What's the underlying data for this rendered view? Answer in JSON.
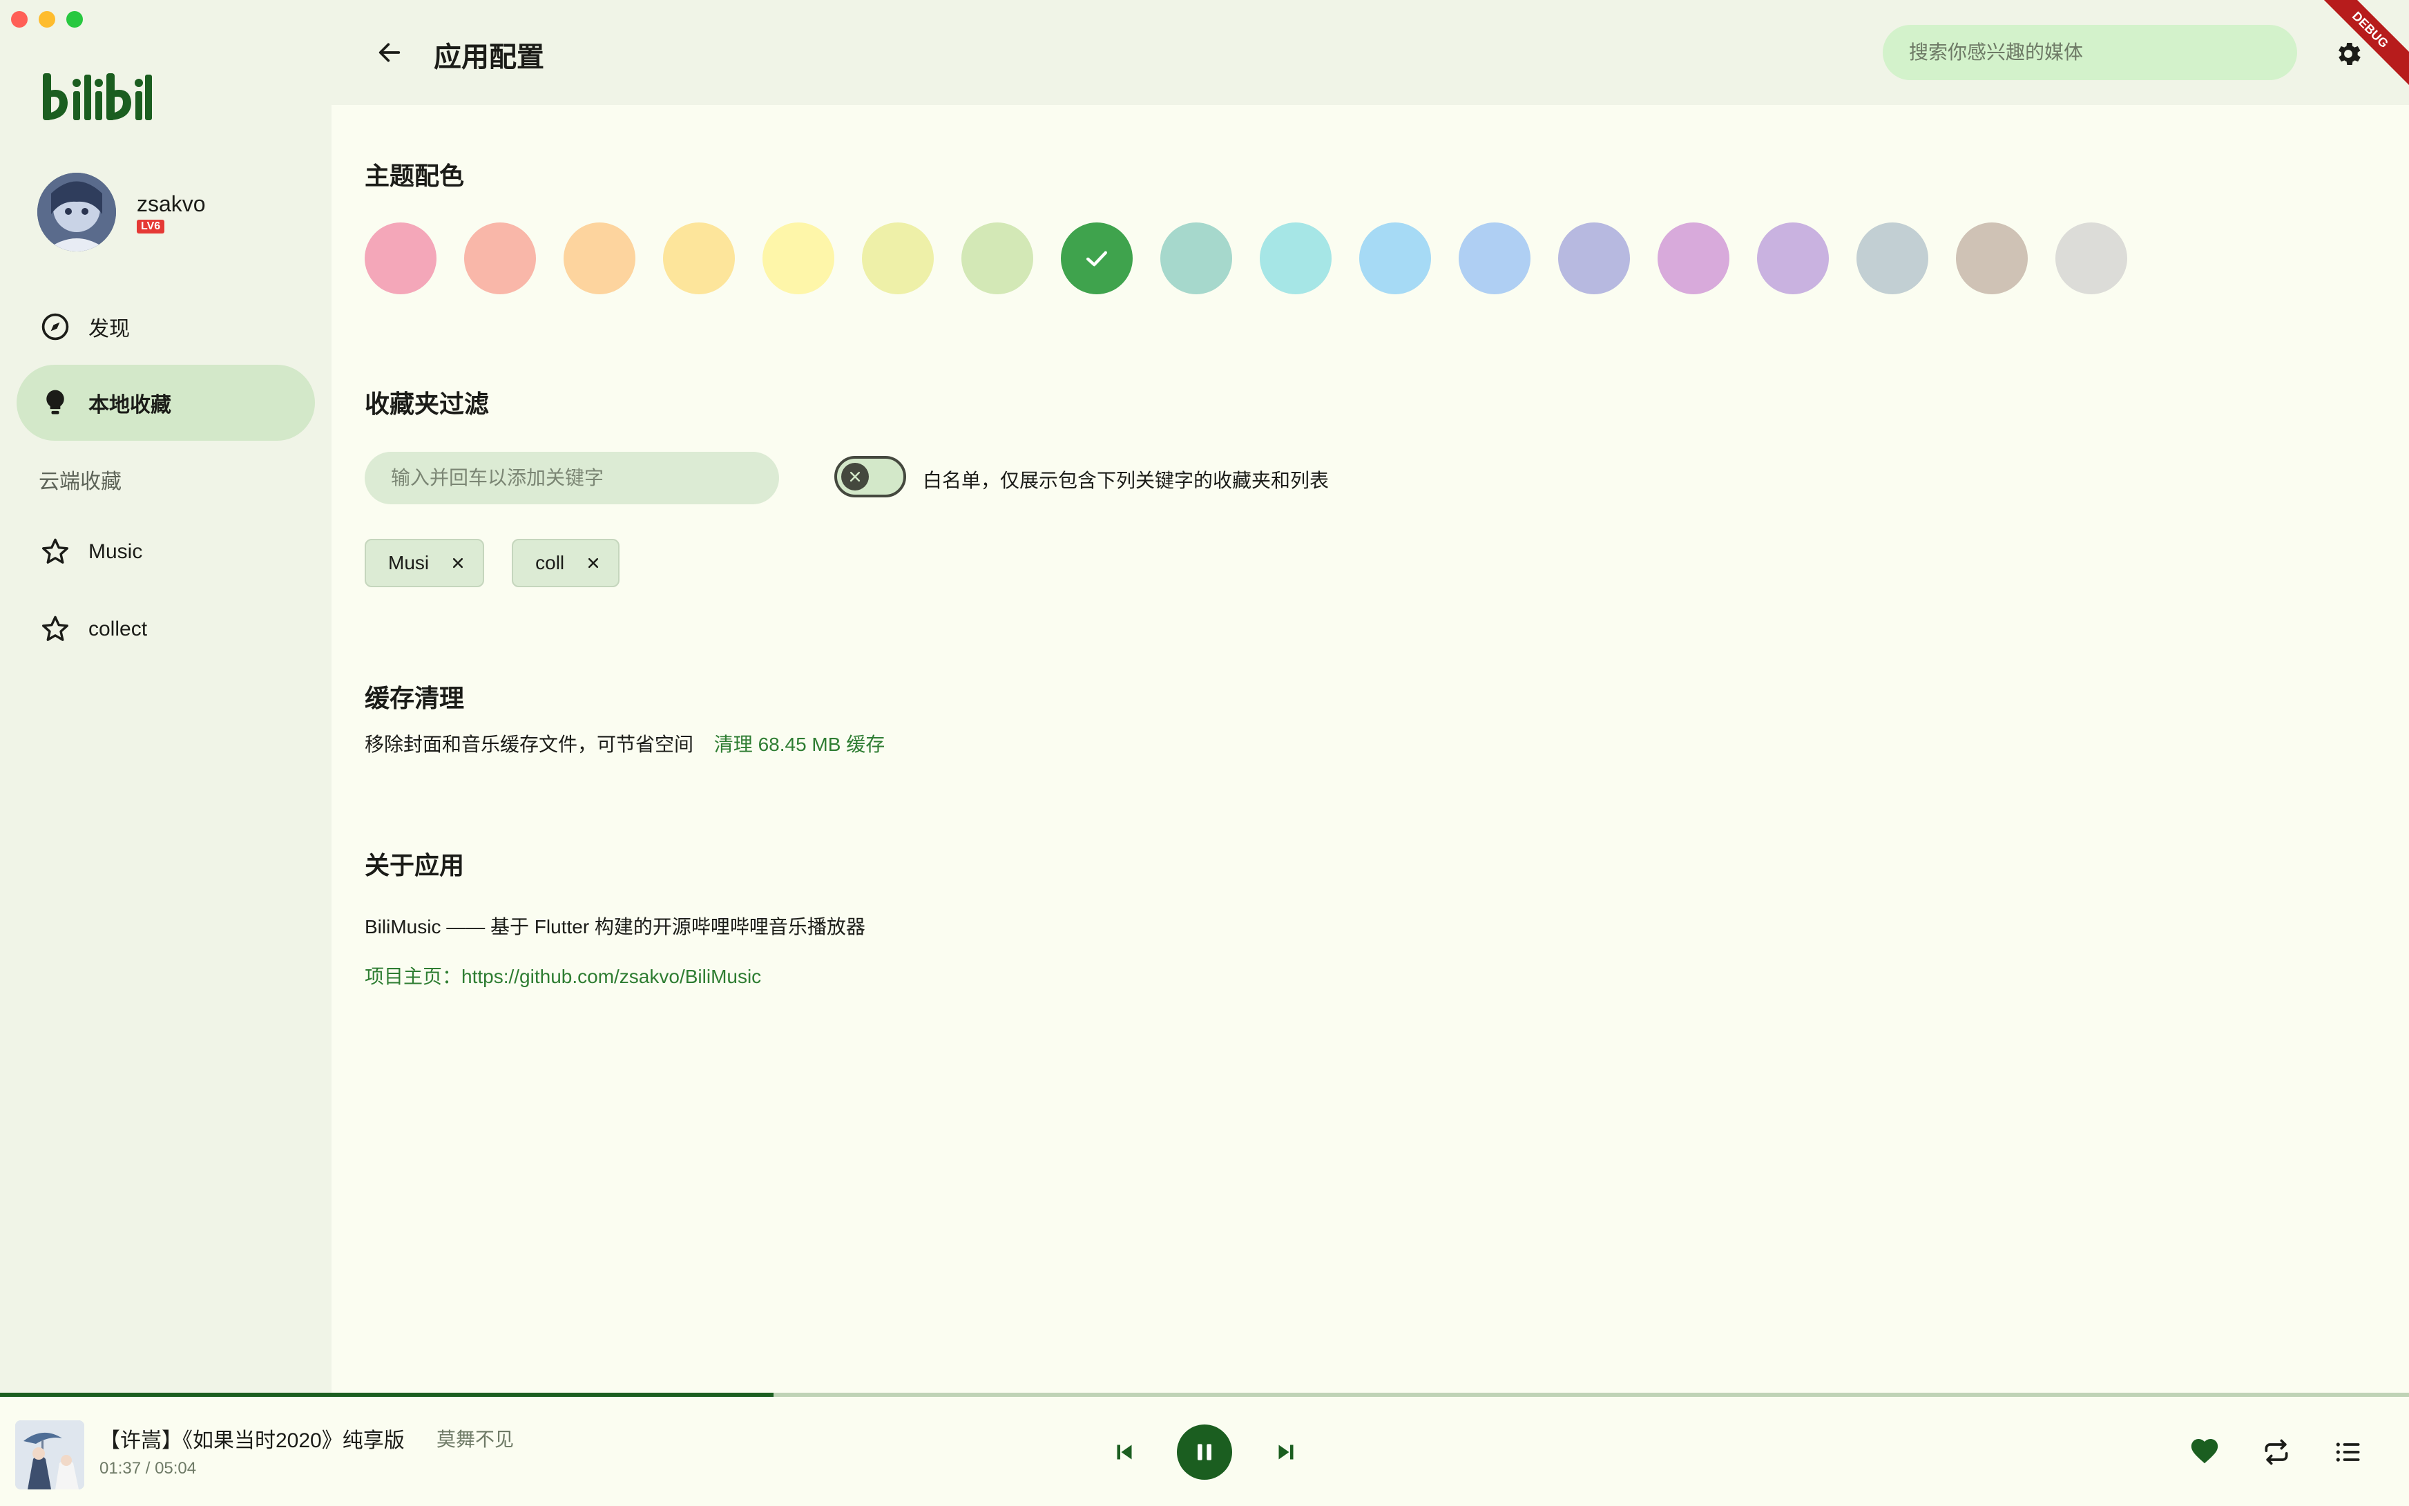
{
  "window": {
    "traffic_colors": [
      "#ff5f57",
      "#febc2e",
      "#28c840"
    ]
  },
  "sidebar": {
    "logo_text": "bilibili",
    "user": {
      "name": "zsakvo",
      "level": "LV6"
    },
    "items": [
      {
        "label": "发现",
        "icon": "compass-icon",
        "active": false
      },
      {
        "label": "本地收藏",
        "icon": "bulb-icon",
        "active": true
      }
    ],
    "cloud_section_label": "云端收藏",
    "cloud_items": [
      {
        "label": "Music",
        "icon": "star-icon"
      },
      {
        "label": "collect",
        "icon": "star-icon"
      }
    ]
  },
  "header": {
    "title": "应用配置",
    "search_placeholder": "搜索你感兴趣的媒体",
    "debug_label": "DEBUG"
  },
  "theme": {
    "title": "主题配色",
    "selected_index": 7,
    "colors": [
      "#f4a7b9",
      "#f9b7a9",
      "#fdd49e",
      "#fde59b",
      "#fef6a9",
      "#eef0a8",
      "#d3e8b6",
      "#3fa34d",
      "#a6d8cc",
      "#a6e6e6",
      "#a6daf5",
      "#afcff3",
      "#b7b9e0",
      "#d8aadb",
      "#c9b2e0",
      "#c2cfd3",
      "#cfc2b5",
      "#dcdcd8"
    ]
  },
  "filter": {
    "title": "收藏夹过滤",
    "input_placeholder": "输入并回车以添加关键字",
    "whitelist_enabled": false,
    "toggle_label": "白名单，仅展示包含下列关键字的收藏夹和列表",
    "keywords": [
      "Musi",
      "coll"
    ]
  },
  "cache": {
    "title": "缓存清理",
    "desc": "移除封面和音乐缓存文件，可节省空间",
    "clear_label": "清理 68.45 MB 缓存"
  },
  "about": {
    "title": "关于应用",
    "desc": "BiliMusic —— 基于 Flutter 构建的开源哔哩哔哩音乐播放器",
    "homepage_prefix": "项目主页：",
    "homepage_url": "https://github.com/zsakvo/BiliMusic"
  },
  "player": {
    "title": "【许嵩】《如果当时2020》纯享版",
    "artist": "莫舞不见",
    "time": "01:37 / 05:04",
    "progress": 0.321,
    "liked": true
  },
  "colors": {
    "primary": "#1b5e20",
    "accent_link": "#2e7d32",
    "sidebar_bg": "#f0f4e7",
    "main_bg": "#fbfdf1"
  }
}
